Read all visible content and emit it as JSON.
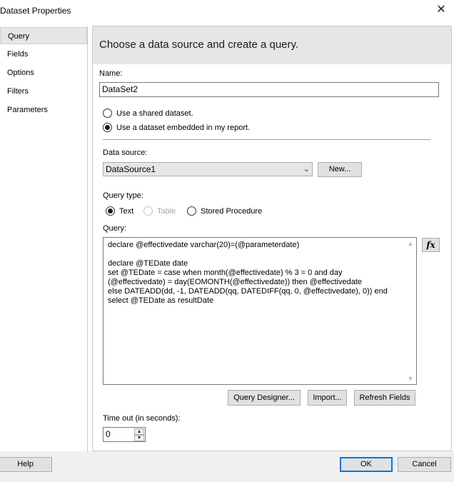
{
  "window": {
    "title": "Dataset Properties",
    "close_glyph": "✕"
  },
  "nav": {
    "items": [
      {
        "label": "Query",
        "selected": true
      },
      {
        "label": "Fields",
        "selected": false
      },
      {
        "label": "Options",
        "selected": false
      },
      {
        "label": "Filters",
        "selected": false
      },
      {
        "label": "Parameters",
        "selected": false
      }
    ]
  },
  "main": {
    "header": "Choose a data source and create a query.",
    "name_label": "Name:",
    "name_value": "DataSet2",
    "dataset_options": [
      {
        "label": "Use a shared dataset.",
        "checked": false
      },
      {
        "label": "Use a dataset embedded in my report.",
        "checked": true
      }
    ],
    "datasource_label": "Data source:",
    "datasource_value": "DataSource1",
    "new_button": "New...",
    "querytype_label": "Query type:",
    "query_types": [
      {
        "label": "Text",
        "checked": true,
        "disabled": false
      },
      {
        "label": "Table",
        "checked": false,
        "disabled": true
      },
      {
        "label": "Stored Procedure",
        "checked": false,
        "disabled": false
      }
    ],
    "query_label": "Query:",
    "query_text": "declare @effectivedate varchar(20)=(@parameterdate)\n\ndeclare @TEDate date\nset @TEDate = case when month(@effectivedate) % 3 = 0 and day\n(@effectivedate) = day(EOMONTH(@effectivedate)) then @effectivedate\nelse DATEADD(dd, -1, DATEADD(qq, DATEDIFF(qq, 0, @effectivedate), 0)) end\nselect @TEDate as resultDate",
    "fx_label": "fx",
    "query_designer_button": "Query Designer...",
    "import_button": "Import...",
    "refresh_fields_button": "Refresh Fields",
    "timeout_label": "Time out (in seconds):",
    "timeout_value": "0"
  },
  "footer": {
    "help": "Help",
    "ok": "OK",
    "cancel": "Cancel"
  },
  "colors": {
    "header_bg": "#e6e6e6",
    "primary_border": "#0078d7",
    "footer_bg": "#f0f0f0"
  }
}
